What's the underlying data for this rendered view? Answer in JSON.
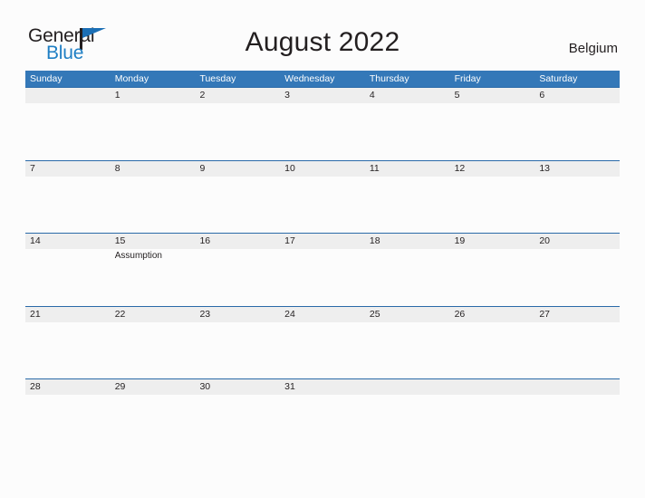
{
  "logo": {
    "text_dark": "General",
    "text_blue": "Blue",
    "flag_icon": "blue-triangle-flag-icon",
    "brand_blue": "#1f7fc4",
    "flag_blue": "#1b6fb5"
  },
  "header": {
    "title": "August 2022",
    "country": "Belgium"
  },
  "colors": {
    "header_blue": "#3478b8",
    "row_rule_blue": "#2a6aa8",
    "date_band_gray": "#eeeeee",
    "page_background": "#fcfcfc",
    "text": "#231f20"
  },
  "calendar": {
    "day_names": [
      "Sunday",
      "Monday",
      "Tuesday",
      "Wednesday",
      "Thursday",
      "Friday",
      "Saturday"
    ],
    "weeks": [
      {
        "days": [
          {
            "date": "",
            "event": ""
          },
          {
            "date": "1",
            "event": ""
          },
          {
            "date": "2",
            "event": ""
          },
          {
            "date": "3",
            "event": ""
          },
          {
            "date": "4",
            "event": ""
          },
          {
            "date": "5",
            "event": ""
          },
          {
            "date": "6",
            "event": ""
          }
        ]
      },
      {
        "days": [
          {
            "date": "7",
            "event": ""
          },
          {
            "date": "8",
            "event": ""
          },
          {
            "date": "9",
            "event": ""
          },
          {
            "date": "10",
            "event": ""
          },
          {
            "date": "11",
            "event": ""
          },
          {
            "date": "12",
            "event": ""
          },
          {
            "date": "13",
            "event": ""
          }
        ]
      },
      {
        "days": [
          {
            "date": "14",
            "event": ""
          },
          {
            "date": "15",
            "event": "Assumption"
          },
          {
            "date": "16",
            "event": ""
          },
          {
            "date": "17",
            "event": ""
          },
          {
            "date": "18",
            "event": ""
          },
          {
            "date": "19",
            "event": ""
          },
          {
            "date": "20",
            "event": ""
          }
        ]
      },
      {
        "days": [
          {
            "date": "21",
            "event": ""
          },
          {
            "date": "22",
            "event": ""
          },
          {
            "date": "23",
            "event": ""
          },
          {
            "date": "24",
            "event": ""
          },
          {
            "date": "25",
            "event": ""
          },
          {
            "date": "26",
            "event": ""
          },
          {
            "date": "27",
            "event": ""
          }
        ]
      },
      {
        "days": [
          {
            "date": "28",
            "event": ""
          },
          {
            "date": "29",
            "event": ""
          },
          {
            "date": "30",
            "event": ""
          },
          {
            "date": "31",
            "event": ""
          },
          {
            "date": "",
            "event": ""
          },
          {
            "date": "",
            "event": ""
          },
          {
            "date": "",
            "event": ""
          }
        ]
      }
    ]
  }
}
